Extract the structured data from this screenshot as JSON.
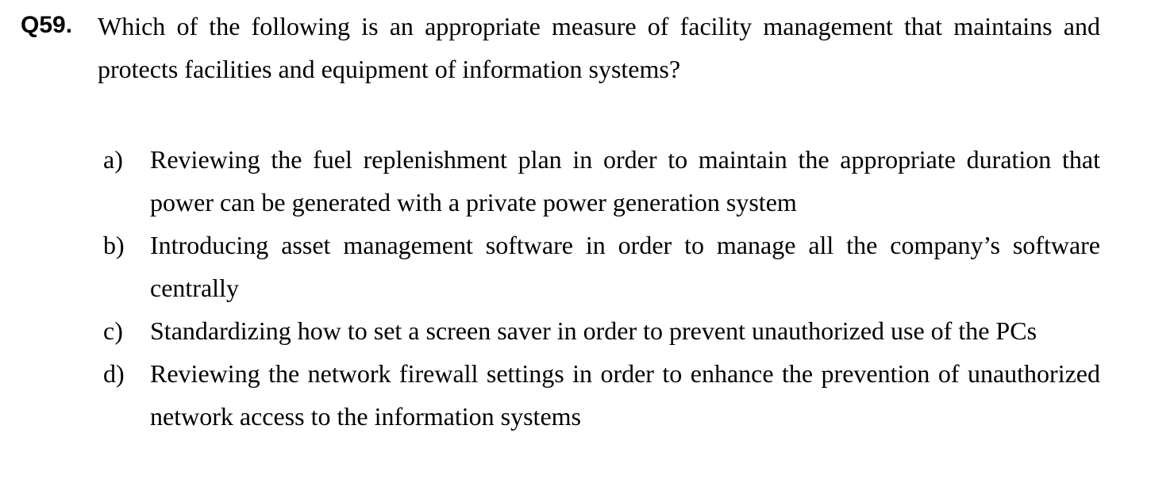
{
  "question": {
    "number": "Q59.",
    "text": "Which of the following is an appropriate measure of facility management that maintains and protects facilities and equipment of information systems?"
  },
  "options": [
    {
      "letter": "a)",
      "text": "Reviewing the fuel replenishment plan in order to maintain the appropriate duration that power can be generated with a private power generation system"
    },
    {
      "letter": "b)",
      "text": "Introducing asset management software in order to manage all the company’s software centrally"
    },
    {
      "letter": "c)",
      "text": "Standardizing how to set a screen saver in order to prevent unauthorized use of the PCs"
    },
    {
      "letter": "d)",
      "text": "Reviewing the network firewall settings in order to enhance the prevention of unauthorized network access to the information systems"
    }
  ]
}
